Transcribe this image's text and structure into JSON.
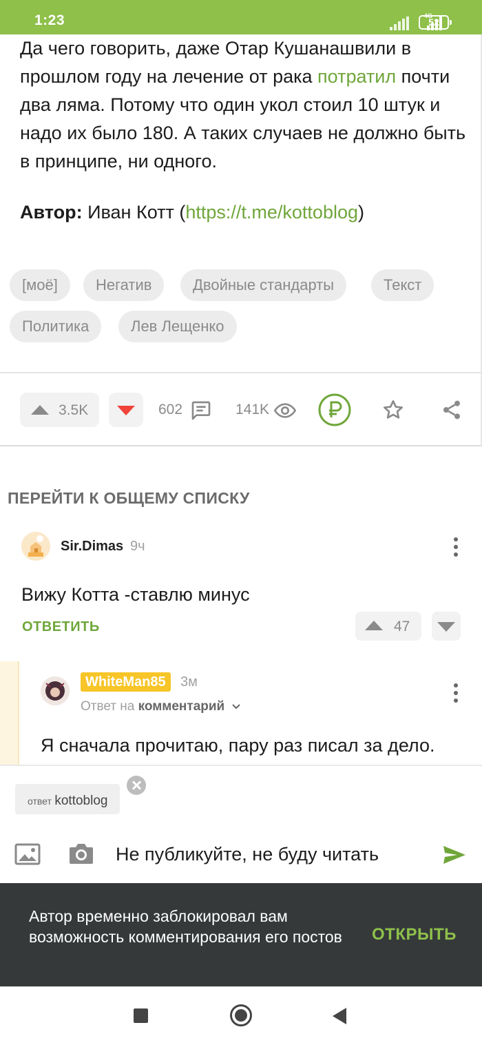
{
  "status_bar": {
    "time": "1:23",
    "network": "4G",
    "battery": "52"
  },
  "article": {
    "paragraph_before_link": "Да чего говорить, даже Отар Кушанашвили в прошлом году на лечение от рака ",
    "paragraph_link": "потратил",
    "paragraph_after_link": " почти два ляма. Потому что один укол стоил 10 штук и надо их было 180. А таких случаев не должно быть в принципе, ни одного.",
    "author_label": "Автор:",
    "author_name": " Иван Котт (",
    "author_link": "https://t.me/kottoblog",
    "author_close": ")"
  },
  "tags": [
    "[моё]",
    "Негатив",
    "Двойные стандарты",
    "Текст",
    "Политика",
    "Лев Лещенко"
  ],
  "actions": {
    "upvotes": "3.5K",
    "comments": "602",
    "views": "141K"
  },
  "comments_section": {
    "goto_list": "ПЕРЕЙТИ К ОБЩЕМУ СПИСКУ",
    "comment1": {
      "user": "Sir.Dimas",
      "time": "9ч",
      "text": "Вижу Котта -ставлю минус",
      "reply_label": "ОТВЕТИТЬ",
      "rating": "47"
    },
    "comment2": {
      "user": "WhiteMan85",
      "time": "3м",
      "reply_prefix": "Ответ на",
      "reply_target": "комментарий",
      "text": "Я сначала прочитаю, пару раз писал за дело."
    }
  },
  "reply_box": {
    "chip_label": "ответ",
    "chip_name": "kottoblog",
    "input_value": "Не публикуйте, не буду читать"
  },
  "snackbar": {
    "message": "Автор временно заблокировал вам возможность комментирования его постов",
    "action": "ОТКРЫТЬ"
  },
  "colors": {
    "accent": "#8ec04a",
    "link": "#6fa63a",
    "downvote": "#f0433a",
    "user_badge": "#f7c527",
    "snackbar": "#35393a"
  }
}
